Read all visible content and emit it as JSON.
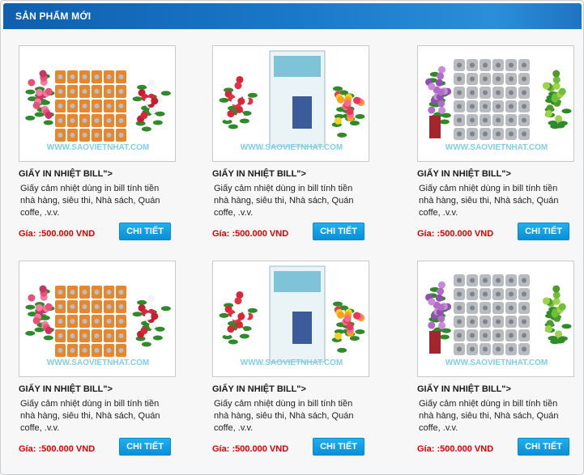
{
  "section": {
    "title": "SẢN PHẨM MỚI"
  },
  "products": [
    {
      "title": "GIẤY IN NHIỆT BILL\">",
      "description": "Giấy cảm nhiệt dùng in bill tính tiền nhà hàng, siêu thi, Nhà sách, Quán coffe, .v.v.",
      "price": "Gía: :500.000 VND",
      "button_label": "CHI TIẾT",
      "image_watermark": "WWW.SAOVIETNHAT.COM",
      "image_variant": "rolls-orange"
    },
    {
      "title": "GIẤY IN NHIỆT BILL\">",
      "description": "Giấy cảm nhiệt dùng in bill tính tiền nhà hàng, siêu thi, Nhà sách, Quán coffe, .v.v.",
      "price": "Gía: :500.000 VND",
      "button_label": "CHI TIẾT",
      "image_watermark": "WWW.SAOVIETNHAT.COM",
      "image_variant": "box-flowers"
    },
    {
      "title": "GIẤY IN NHIỆT BILL\">",
      "description": "Giấy cảm nhiệt dùng in bill tính tiền nhà hàng, siêu thi, Nhà sách, Quán coffe, .v.v.",
      "price": "Gía: :500.000 VND",
      "button_label": "CHI TIẾT",
      "image_watermark": "WWW.SAOVIETNHAT.COM",
      "image_variant": "rolls-grey"
    },
    {
      "title": "GIẤY IN NHIỆT BILL\">",
      "description": "Giấy cảm nhiệt dùng in bill tính tiền nhà hàng, siêu thi, Nhà sách, Quán coffe, .v.v.",
      "price": "Gía: :500.000 VND",
      "button_label": "CHI TIẾT",
      "image_watermark": "WWW.SAOVIETNHAT.COM",
      "image_variant": "rolls-orange"
    },
    {
      "title": "GIẤY IN NHIỆT BILL\">",
      "description": "Giấy cảm nhiệt dùng in bill tính tiền nhà hàng, siêu thi, Nhà sách, Quán coffe, .v.v.",
      "price": "Gía: :500.000 VND",
      "button_label": "CHI TIẾT",
      "image_watermark": "WWW.SAOVIETNHAT.COM",
      "image_variant": "box-flowers"
    },
    {
      "title": "GIẤY IN NHIỆT BILL\">",
      "description": "Giấy cảm nhiệt dùng in bill tính tiền nhà hàng, siêu thi, Nhà sách, Quán coffe, .v.v.",
      "price": "Gía: :500.000 VND",
      "button_label": "CHI TIẾT",
      "image_watermark": "WWW.SAOVIETNHAT.COM",
      "image_variant": "rolls-grey"
    }
  ],
  "colors": {
    "header_blue": "#1a78c8",
    "price_red": "#e00000",
    "button_blue": "#0a8fd8"
  }
}
